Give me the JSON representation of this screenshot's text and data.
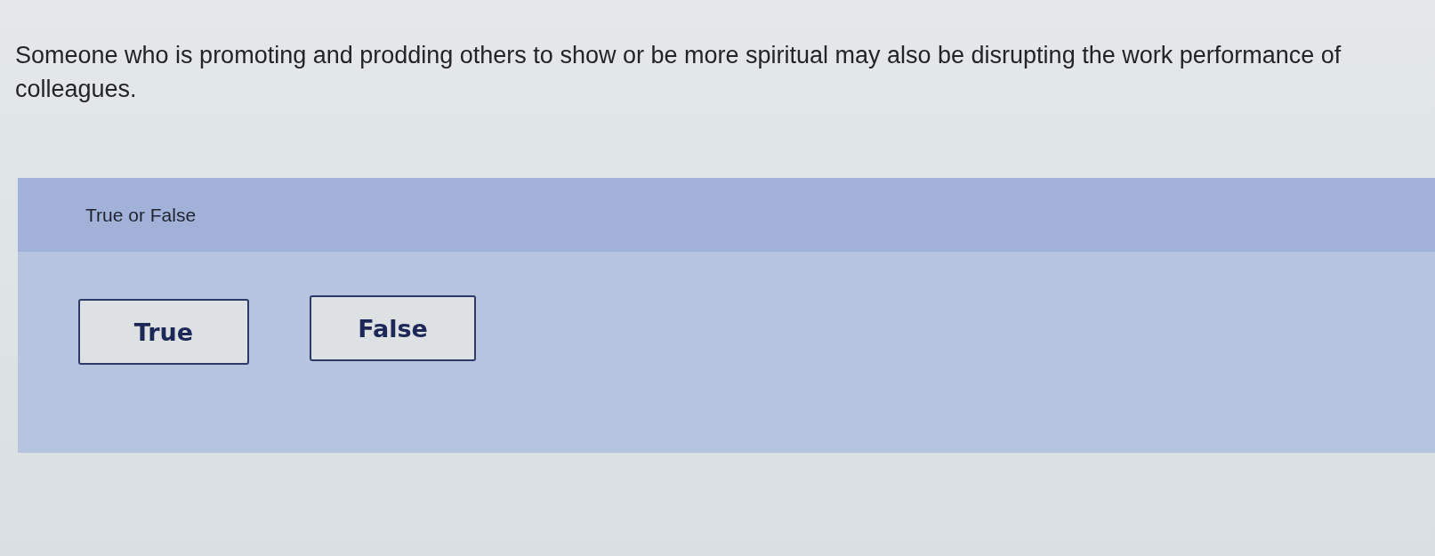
{
  "question": {
    "text": "Someone who is promoting and prodding others to show or be more spiritual may also be disrupting the work performance of colleagues."
  },
  "answer_panel": {
    "prompt": "True or False",
    "options": [
      {
        "label": "True"
      },
      {
        "label": "False"
      }
    ]
  }
}
